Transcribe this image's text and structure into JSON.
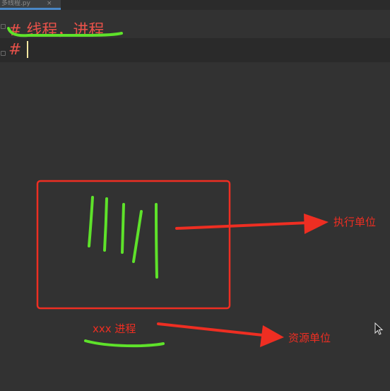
{
  "editor_tab": {
    "title": "多线程.py",
    "close_glyph": "×"
  },
  "code": {
    "line1": "# 线程，进程",
    "line2": "#"
  },
  "annotations": {
    "box_caption": "xxx 进程",
    "thread_label": "执行单位",
    "process_label": "资源单位",
    "colors": {
      "marker_red": "#ee2e22",
      "marker_green": "#5ee22a"
    }
  },
  "icons": {
    "cursor": "mouse-pointer-icon"
  }
}
